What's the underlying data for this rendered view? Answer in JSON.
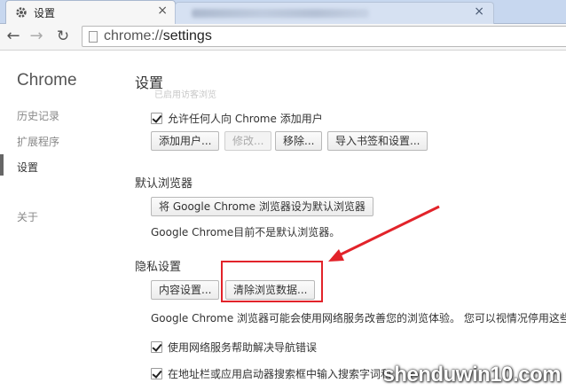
{
  "browser": {
    "active_tab_title": "设置",
    "url_scheme": "chrome://",
    "url_path": "settings"
  },
  "sidebar": {
    "brand": "Chrome",
    "items": [
      {
        "label": "历史记录"
      },
      {
        "label": "扩展程序"
      },
      {
        "label": "设置"
      },
      {
        "label": "关于"
      }
    ]
  },
  "page": {
    "title": "设置",
    "ghost_text": "已启用访客浏览",
    "users": {
      "allow_any_user_label": "允许任何人向 Chrome 添加用户",
      "buttons": [
        "添加用户...",
        "修改...",
        "移除...",
        "导入书签和设置..."
      ]
    },
    "default_browser": {
      "heading": "默认浏览器",
      "set_default_button": "将 Google Chrome 浏览器设为默认浏览器",
      "status": "Google Chrome目前不是默认浏览器。"
    },
    "privacy": {
      "heading": "隐私设置",
      "content_settings_button": "内容设置...",
      "clear_data_button": "清除浏览数据...",
      "description": "Google Chrome 浏览器可能会使用网络服务改善您的浏览体验。 您可以视情况停用这些服",
      "nav_errors_label": "使用网络服务帮助解决导航错误",
      "search_predict_label": "在地址栏或应用启动器搜索框中输入搜索字词和"
    }
  },
  "watermark": "shenduwin10.com",
  "colors": {
    "annotation": "#e2232a"
  }
}
